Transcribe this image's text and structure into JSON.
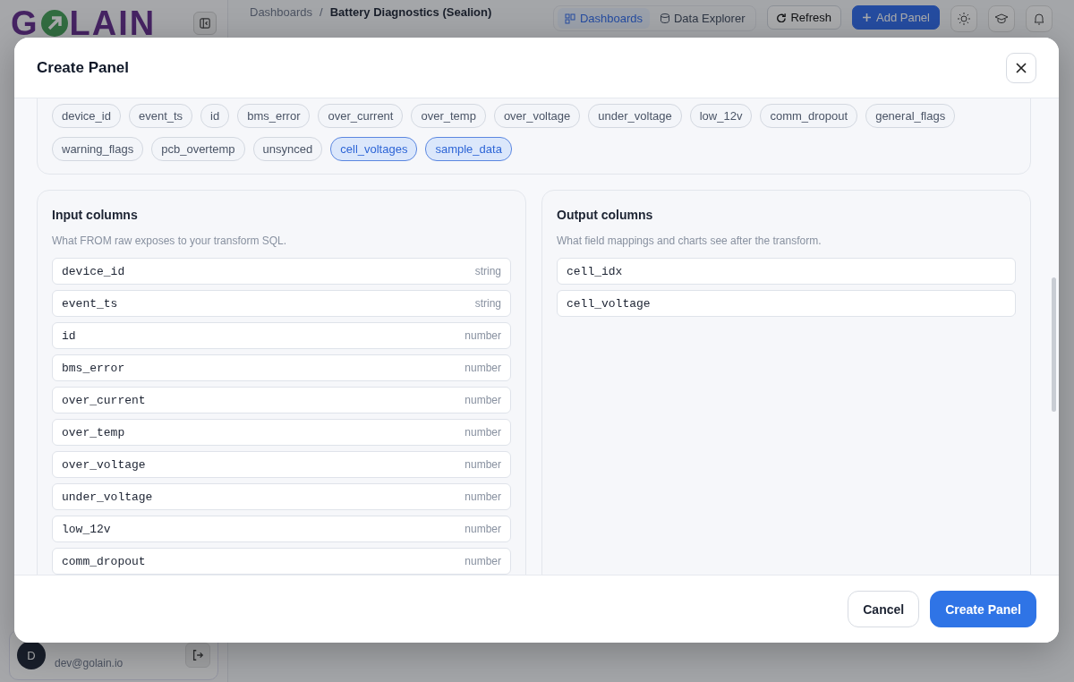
{
  "app": {
    "logo_start": "G",
    "logo_end": "LAIN",
    "breadcrumb": [
      "Dashboards",
      "Battery Diagnostics (Sealion)"
    ],
    "breadcrumb_separator": "/",
    "view_tabs": [
      {
        "label": "Dashboards",
        "selected": true
      },
      {
        "label": "Data Explorer",
        "selected": false
      }
    ],
    "toolbar_buttons": [
      {
        "label": "Refresh",
        "kind": "secondary"
      },
      {
        "label": "Add Panel",
        "kind": "primary"
      }
    ],
    "user": {
      "avatar": "D",
      "email": "dev@golain.io"
    }
  },
  "modal": {
    "title": "Create Panel",
    "chips": [
      {
        "label": "device_id",
        "selected": false
      },
      {
        "label": "event_ts",
        "selected": false
      },
      {
        "label": "id",
        "selected": false
      },
      {
        "label": "bms_error",
        "selected": false
      },
      {
        "label": "over_current",
        "selected": false
      },
      {
        "label": "over_temp",
        "selected": false
      },
      {
        "label": "over_voltage",
        "selected": false
      },
      {
        "label": "under_voltage",
        "selected": false
      },
      {
        "label": "low_12v",
        "selected": false
      },
      {
        "label": "comm_dropout",
        "selected": false
      },
      {
        "label": "general_flags",
        "selected": false
      },
      {
        "label": "warning_flags",
        "selected": false
      },
      {
        "label": "pcb_overtemp",
        "selected": false
      },
      {
        "label": "unsynced",
        "selected": false
      },
      {
        "label": "cell_voltages",
        "selected": true
      },
      {
        "label": "sample_data",
        "selected": true
      }
    ],
    "input_columns": {
      "title": "Input columns",
      "subtitle": "What FROM raw exposes to your transform SQL.",
      "rows": [
        {
          "name": "device_id",
          "type": "string"
        },
        {
          "name": "event_ts",
          "type": "string"
        },
        {
          "name": "id",
          "type": "number"
        },
        {
          "name": "bms_error",
          "type": "number"
        },
        {
          "name": "over_current",
          "type": "number"
        },
        {
          "name": "over_temp",
          "type": "number"
        },
        {
          "name": "over_voltage",
          "type": "number"
        },
        {
          "name": "under_voltage",
          "type": "number"
        },
        {
          "name": "low_12v",
          "type": "number"
        },
        {
          "name": "comm_dropout",
          "type": "number"
        }
      ]
    },
    "output_columns": {
      "title": "Output columns",
      "subtitle": "What field mappings and charts see after the transform.",
      "rows": [
        {
          "name": "cell_idx"
        },
        {
          "name": "cell_voltage"
        }
      ]
    },
    "buttons": [
      {
        "label": "Cancel",
        "kind": "secondary"
      },
      {
        "label": "Create Panel",
        "kind": "primary"
      }
    ]
  }
}
